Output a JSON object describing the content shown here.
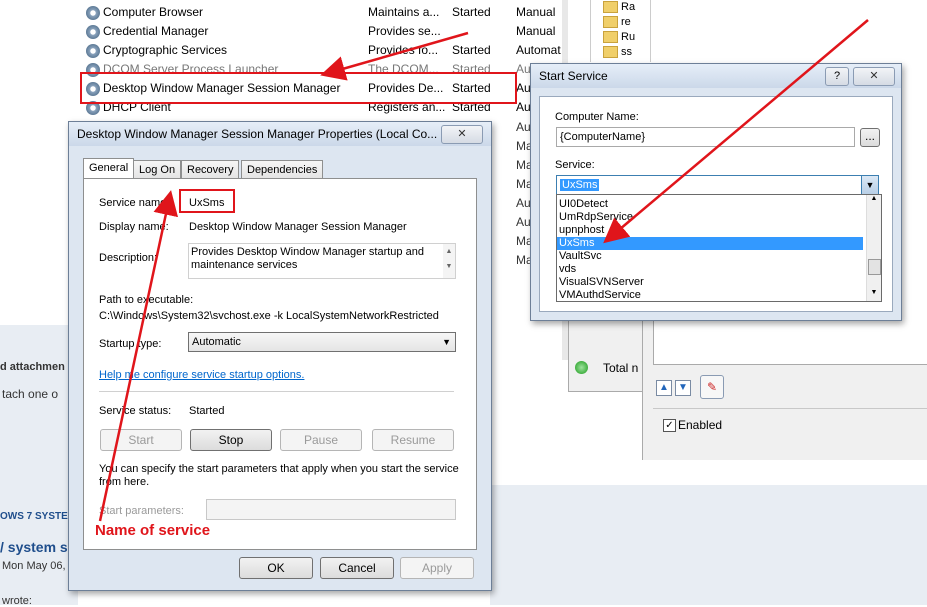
{
  "services": [
    {
      "name": "Computer Browser",
      "description": "Maintains a...",
      "status": "Started",
      "startup": "Manual"
    },
    {
      "name": "Credential Manager",
      "description": "Provides se...",
      "status": "",
      "startup": "Manual"
    },
    {
      "name": "Cryptographic Services",
      "description": "Provides fo...",
      "status": "Started",
      "startup": "Automat"
    },
    {
      "name": "DCOM Server Process Launcher",
      "description": "The DCOM...",
      "status": "Started",
      "startup": "Au"
    },
    {
      "name": "Desktop Window Manager Session Manager",
      "description": "Provides De...",
      "status": "Started",
      "startup": "Au"
    },
    {
      "name": "DHCP Client",
      "description": "Registers an...",
      "status": "Started",
      "startup": "Au"
    }
  ],
  "startup_column_tail": [
    "Au",
    "Ma",
    "Ma",
    "Ma",
    "Au",
    "Au",
    "Ma",
    "Ma"
  ],
  "tree_items": [
    "Ra",
    "re",
    "Ru",
    "ss"
  ],
  "background": {
    "forum_bold": "d attachmen",
    "forum_text": "tach one o",
    "forum_section": "OWS 7 SYSTE",
    "forum_link": "/ system sp",
    "forum_date": "Mon May 06,",
    "forum_wrote": "wrote:",
    "total_label": "Total n",
    "enabled_label": "Enabled"
  },
  "properties_dialog": {
    "title": "Desktop Window Manager Session Manager Properties (Local Co...",
    "close": "✕",
    "tabs": [
      "General",
      "Log On",
      "Recovery",
      "Dependencies"
    ],
    "service_name_label": "Service name:",
    "service_name": "UxSms",
    "display_name_label": "Display name:",
    "display_name": "Desktop Window Manager Session Manager",
    "description_label": "Description:",
    "description": "Provides Desktop Window Manager startup and maintenance services",
    "path_label": "Path to executable:",
    "path": "C:\\Windows\\System32\\svchost.exe -k LocalSystemNetworkRestricted",
    "startup_type_label": "Startup type:",
    "startup_type": "Automatic",
    "help_link": "Help me configure service startup options.",
    "status_label": "Service status:",
    "status": "Started",
    "buttons": {
      "start": "Start",
      "stop": "Stop",
      "pause": "Pause",
      "resume": "Resume"
    },
    "params_text": "You can specify the start parameters that apply when you start the service from here.",
    "params_label": "Start parameters:",
    "params_value": "",
    "ok": "OK",
    "cancel": "Cancel",
    "apply": "Apply"
  },
  "start_service_dialog": {
    "title": "Start Service",
    "help": "?",
    "close": "✕",
    "computer_label": "Computer Name:",
    "computer_value": "{ComputerName}",
    "browse": "...",
    "service_label": "Service:",
    "service_value": "UxSms",
    "options": [
      "UI0Detect",
      "UmRdpService",
      "upnphost",
      "UxSms",
      "VaultSvc",
      "vds",
      "VisualSVNServer",
      "VMAuthdService"
    ],
    "selected_index": 3
  },
  "annotation": {
    "caption": "Name of service"
  },
  "colors": {
    "annotation_red": "#e0151b",
    "selection_blue": "#3399ff",
    "link_blue": "#0066cc"
  }
}
